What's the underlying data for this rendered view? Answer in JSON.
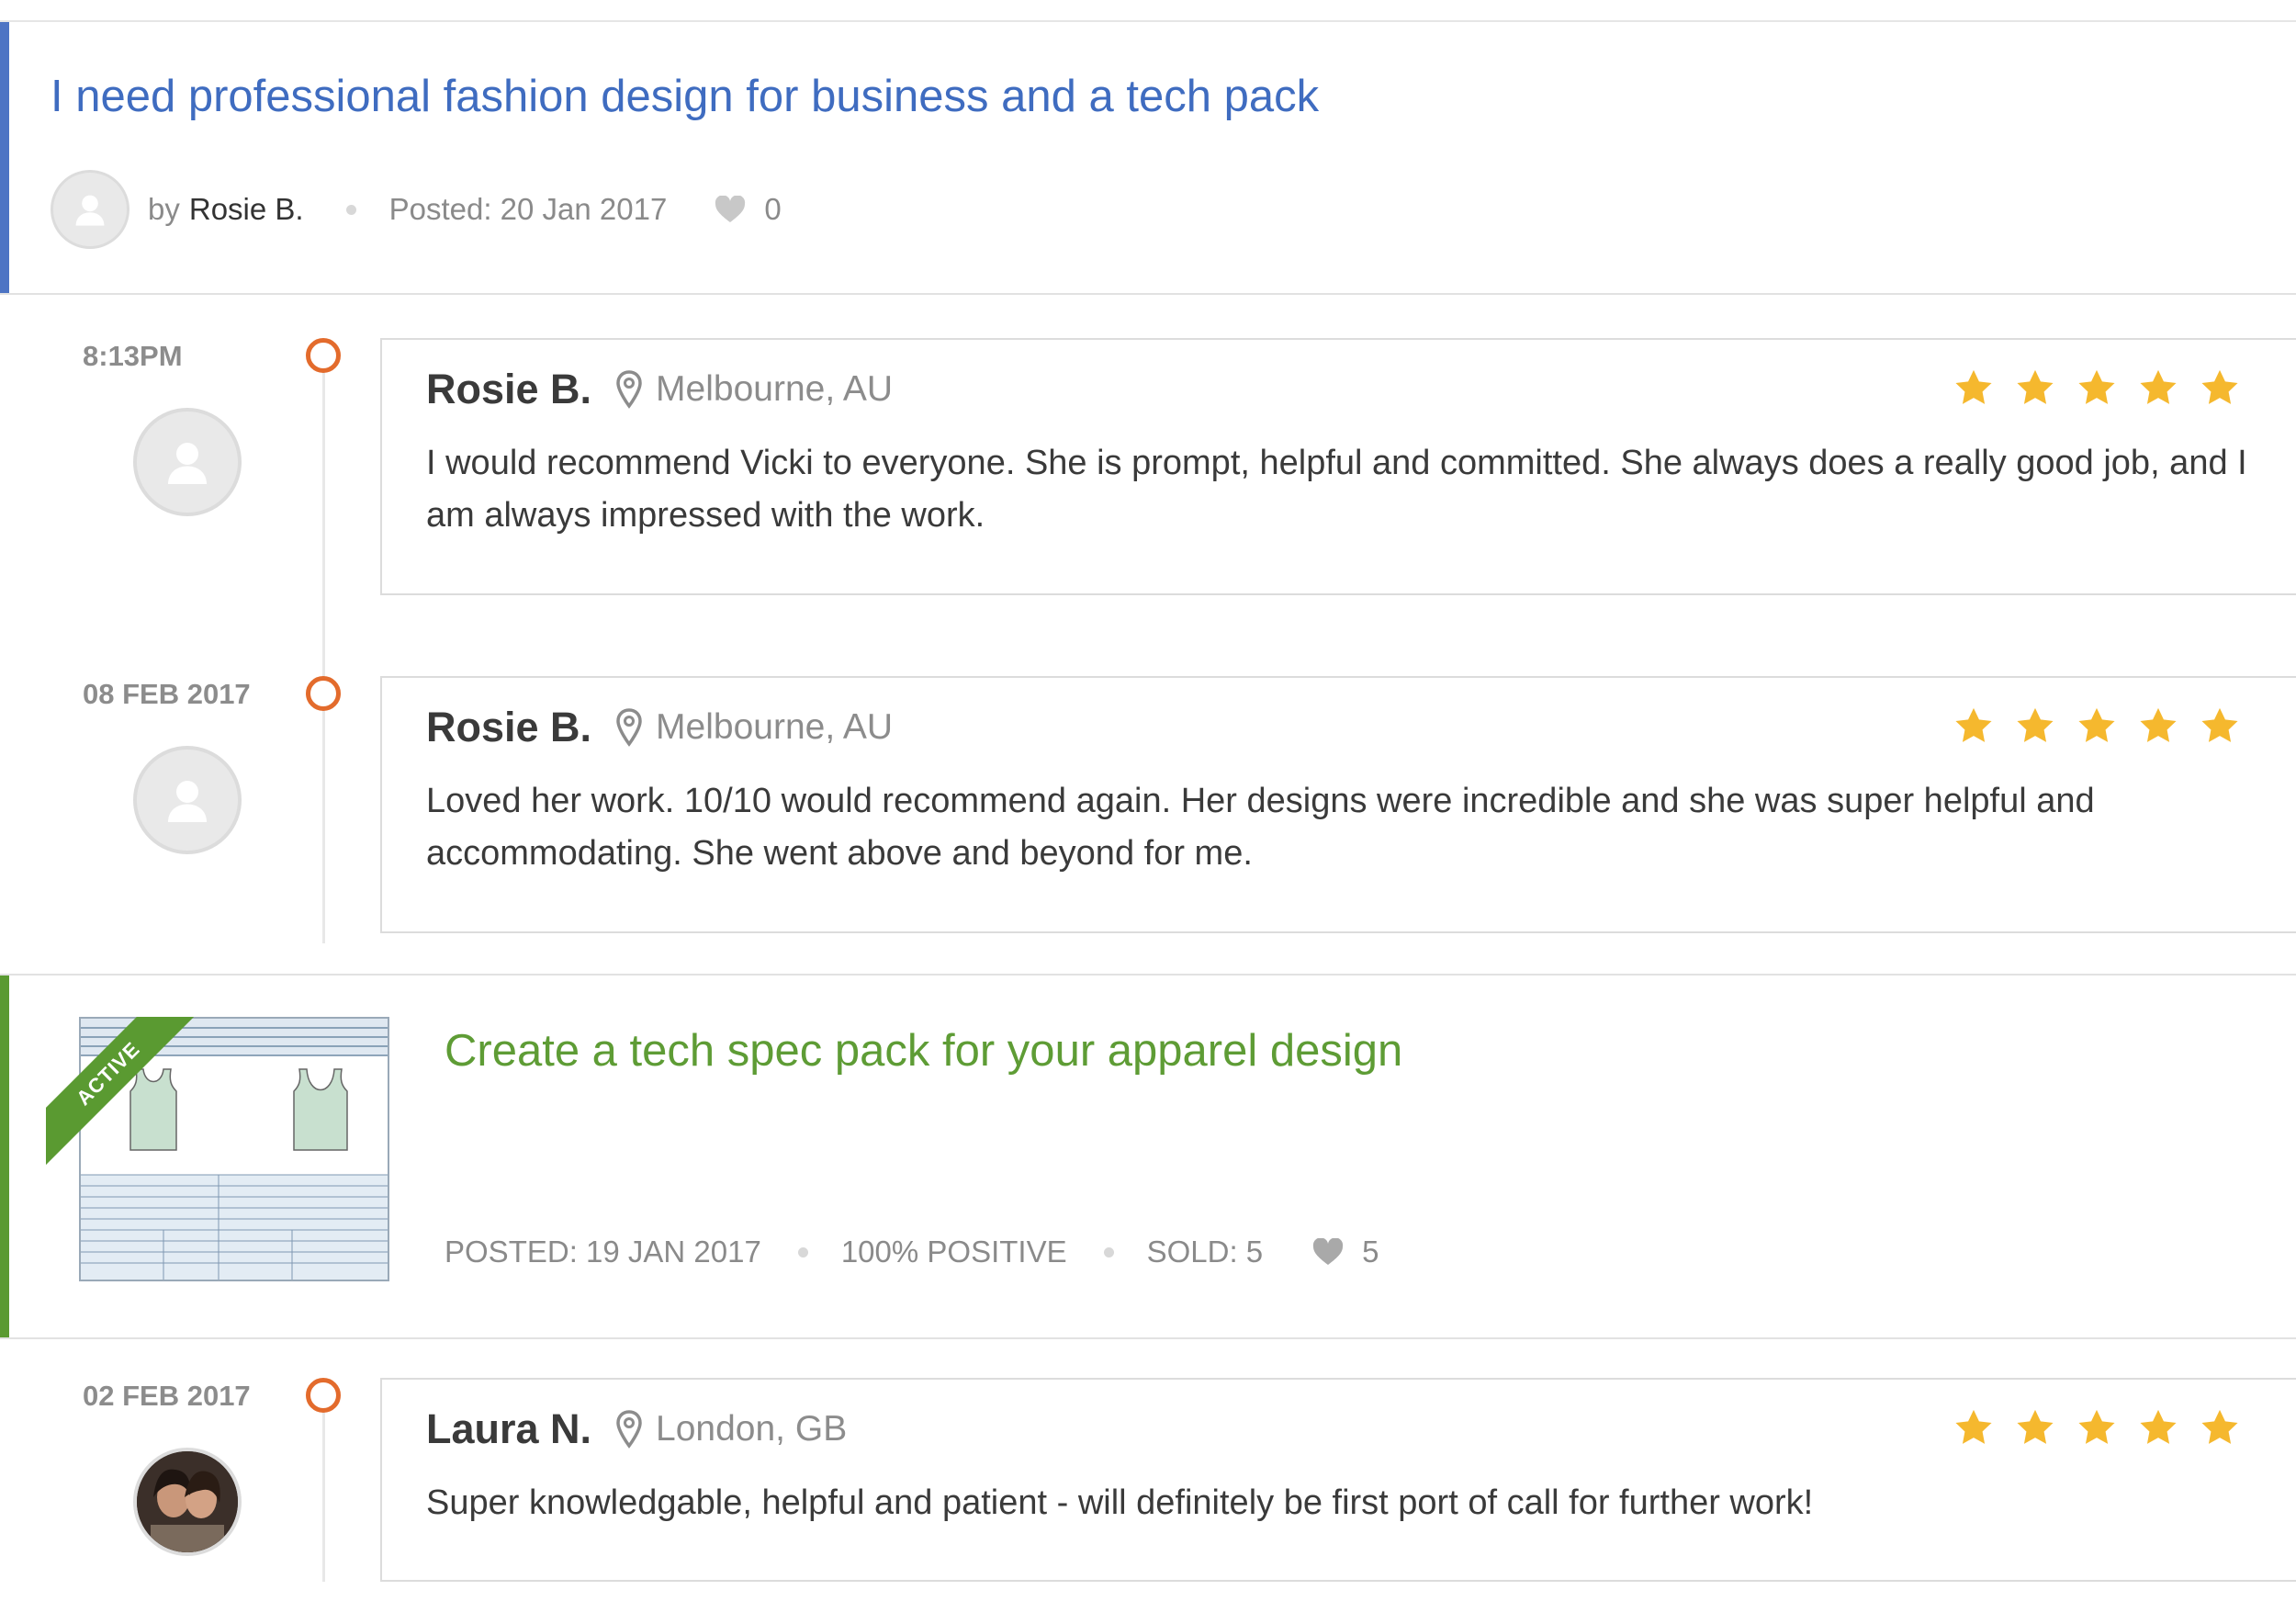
{
  "job": {
    "title": "I need professional fashion design for business and a tech pack",
    "by_label": "by",
    "author": "Rosie B.",
    "posted": "Posted: 20 Jan 2017",
    "likes": "0",
    "accent_color": "#4d74c4"
  },
  "reviews": [
    {
      "time": "8:13PM",
      "name": "Rosie B.",
      "location": "Melbourne, AU",
      "rating": 5,
      "text": "I would recommend Vicki to everyone. She is prompt, helpful and committed. She always does a really good job, and I am always impressed with the work."
    },
    {
      "time": "08 FEB 2017",
      "name": "Rosie B.",
      "location": "Melbourne, AU",
      "rating": 5,
      "text": "Loved her work. 10/10 would recommend again. Her designs were incredible and she was super helpful and accommodating. She went above and beyond for me."
    },
    {
      "time": "02 FEB 2017",
      "name": "Laura N.",
      "location": "London, GB",
      "rating": 5,
      "text": "Super knowledgable, helpful and patient - will definitely be first port of call for further work!"
    }
  ],
  "service": {
    "badge": "ACTIVE",
    "title": "Create a tech spec pack for your apparel design",
    "posted": "POSTED: 19 JAN 2017",
    "positive": "100% POSITIVE",
    "sold": "SOLD: 5",
    "likes": "5",
    "accent_color": "#5a9a31"
  },
  "colors": {
    "timeline_marker": "#e36b2c",
    "star": "#f5b82e",
    "link_blue": "#3f6cc0",
    "link_green": "#5e9c35"
  }
}
